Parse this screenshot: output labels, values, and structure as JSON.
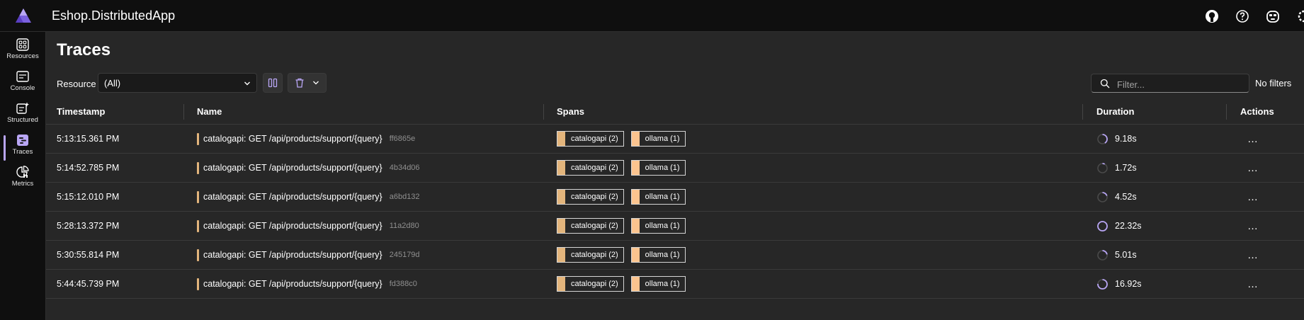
{
  "app": {
    "title": "Eshop.DistributedApp"
  },
  "nav": [
    {
      "label": "Resources",
      "icon": "resources-grid-icon"
    },
    {
      "label": "Console",
      "icon": "console-icon"
    },
    {
      "label": "Structured",
      "icon": "structured-logs-icon"
    },
    {
      "label": "Traces",
      "icon": "traces-icon"
    },
    {
      "label": "Metrics",
      "icon": "metrics-icon"
    }
  ],
  "top_icons": [
    "github-icon",
    "help-icon",
    "copilot-icon"
  ],
  "page": {
    "title": "Traces",
    "resource_label": "Resource",
    "resource_value": "(All)",
    "filter_placeholder": "Filter...",
    "filters_status": "No filters"
  },
  "table": {
    "headers": {
      "timestamp": "Timestamp",
      "name": "Name",
      "spans": "Spans",
      "duration": "Duration",
      "actions": "Actions"
    },
    "actions_label": "…",
    "rows": [
      {
        "timestamp": "5:13:15.361 PM",
        "name": "catalogapi: GET /api/products/support/{query}",
        "id": "ff6865e",
        "spans": [
          "catalogapi (2)",
          "ollama (1)"
        ],
        "duration": "9.18s",
        "progress": 0.41
      },
      {
        "timestamp": "5:14:52.785 PM",
        "name": "catalogapi: GET /api/products/support/{query}",
        "id": "4b34d06",
        "spans": [
          "catalogapi (2)",
          "ollama (1)"
        ],
        "duration": "1.72s",
        "progress": 0.08
      },
      {
        "timestamp": "5:15:12.010 PM",
        "name": "catalogapi: GET /api/products/support/{query}",
        "id": "a6bd132",
        "spans": [
          "catalogapi (2)",
          "ollama (1)"
        ],
        "duration": "4.52s",
        "progress": 0.2
      },
      {
        "timestamp": "5:28:13.372 PM",
        "name": "catalogapi: GET /api/products/support/{query}",
        "id": "11a2d80",
        "spans": [
          "catalogapi (2)",
          "ollama (1)"
        ],
        "duration": "22.32s",
        "progress": 1.0
      },
      {
        "timestamp": "5:30:55.814 PM",
        "name": "catalogapi: GET /api/products/support/{query}",
        "id": "245179d",
        "spans": [
          "catalogapi (2)",
          "ollama (1)"
        ],
        "duration": "5.01s",
        "progress": 0.22
      },
      {
        "timestamp": "5:44:45.739 PM",
        "name": "catalogapi: GET /api/products/support/{query}",
        "id": "fd388c0",
        "spans": [
          "catalogapi (2)",
          "ollama (1)"
        ],
        "duration": "16.92s",
        "progress": 0.76
      }
    ]
  },
  "colors": {
    "accent": "#b9a6f5",
    "catalogapi": "#e3b57c",
    "ollama": "#fbc48f",
    "ring_track": "#4a4a4a"
  }
}
